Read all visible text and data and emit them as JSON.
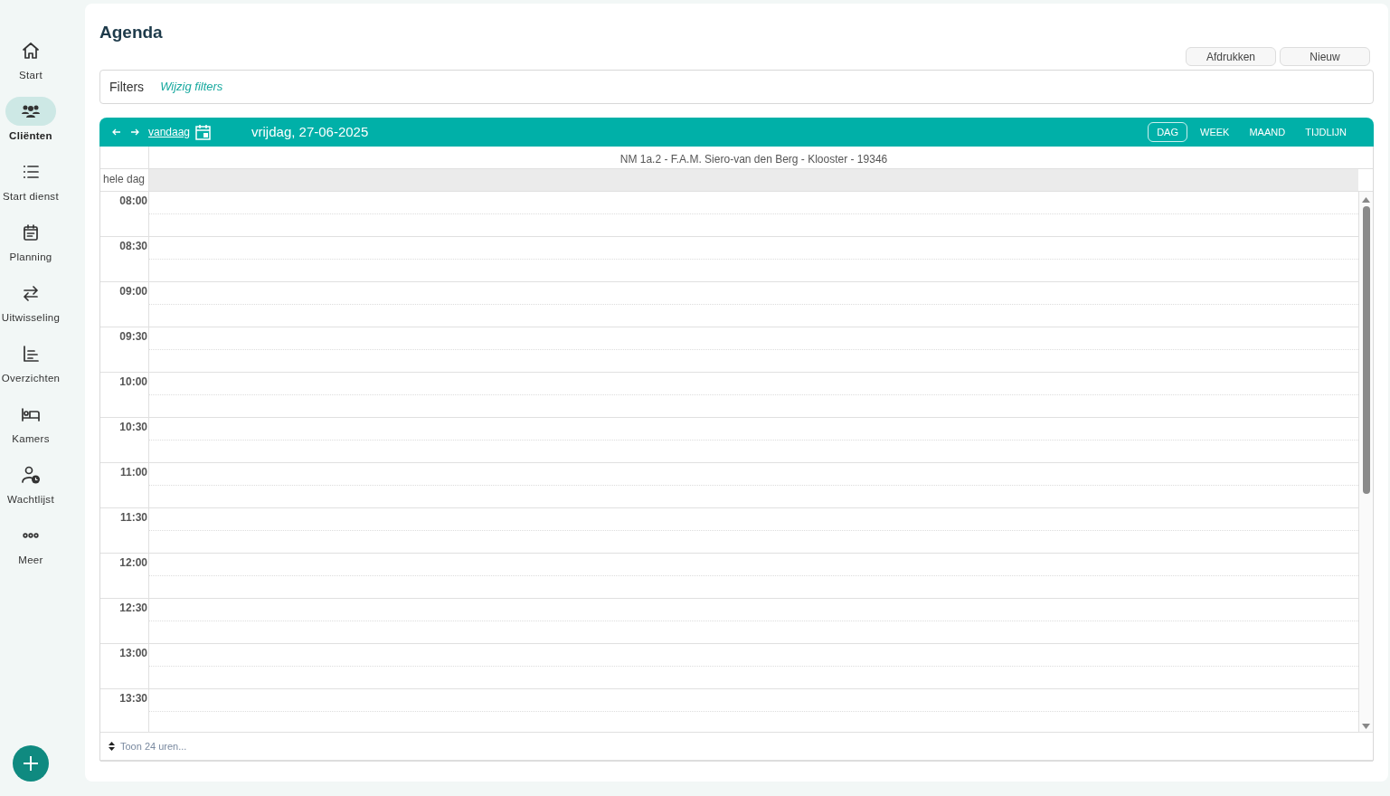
{
  "sidebar": {
    "items": [
      {
        "label": "Start",
        "selected": false
      },
      {
        "label": "Cliënten",
        "selected": true
      },
      {
        "label": "Start dienst",
        "selected": false
      },
      {
        "label": "Planning",
        "selected": false
      },
      {
        "label": "Uitwisseling",
        "selected": false
      },
      {
        "label": "Overzichten",
        "selected": false
      },
      {
        "label": "Kamers",
        "selected": false
      },
      {
        "label": "Wachtlijst",
        "selected": false
      },
      {
        "label": "Meer",
        "selected": false
      }
    ]
  },
  "page": {
    "title": "Agenda",
    "buttons": [
      "Afdrukken",
      "Nieuw"
    ]
  },
  "filters": {
    "label": "Filters",
    "link": "Wijzig filters"
  },
  "calendar": {
    "today": "vandaag",
    "date": "vrijdag, 27-06-2025",
    "views": [
      {
        "label": "DAG",
        "selected": true
      },
      {
        "label": "WEEK",
        "selected": false
      },
      {
        "label": "MAAND",
        "selected": false
      },
      {
        "label": "TIJDLIJN",
        "selected": false
      }
    ],
    "resource": "NM 1a.2 - F.A.M. Siero-van den Berg - Klooster - 19346",
    "all_day": "hele dag",
    "times": [
      "08:00",
      "08:30",
      "09:00",
      "09:30",
      "10:00",
      "10:30",
      "11:00",
      "11:30",
      "12:00",
      "12:30",
      "13:00",
      "13:30"
    ],
    "footer": "Toon 24 uren..."
  }
}
